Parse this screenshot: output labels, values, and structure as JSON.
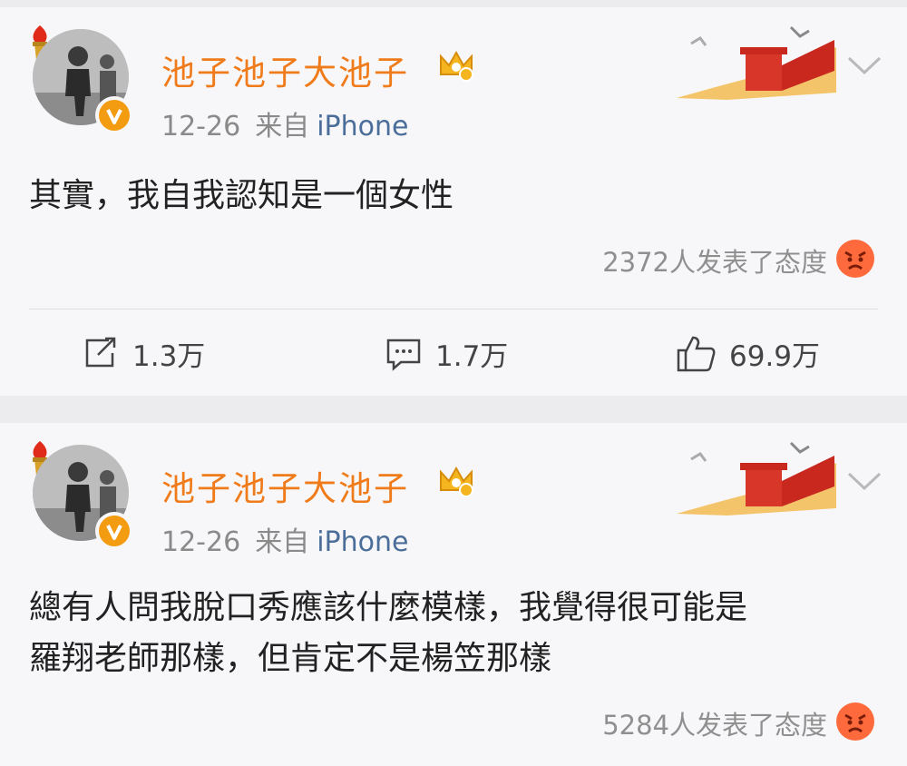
{
  "posts": [
    {
      "author": "池子池子大池子",
      "date": "12-26",
      "source_prefix": "来自",
      "device": "iPhone",
      "text_lines": [
        "其實，我自我認知是一個女性"
      ],
      "reactions": "2372人发表了态度",
      "repost_count": "1.3万",
      "comment_count": "1.7万",
      "like_count": "69.9万"
    },
    {
      "author": "池子池子大池子",
      "date": "12-26",
      "source_prefix": "来自",
      "device": "iPhone",
      "text_lines": [
        "總有人問我脫口秀應該什麼模樣，我覺得很可能是",
        "羅翔老師那樣，但肯定不是楊笠那樣"
      ],
      "reactions": "5284人发表了态度"
    }
  ],
  "icons": {
    "avatar": "avatar-photo",
    "verified": "verified-v-badge",
    "member": "crown-badge",
    "decoration": "great-wall-icon",
    "menu": "chevron-down-icon",
    "reaction": "angry-face-icon",
    "repost": "repost-icon",
    "comment": "comment-icon",
    "like": "thumbs-up-icon"
  },
  "colors": {
    "author": "#f07b1a",
    "device": "#4a6e99",
    "meta": "#8a8a8a",
    "verified": "#f39c12",
    "reaction_face": "#ff6a3d"
  }
}
